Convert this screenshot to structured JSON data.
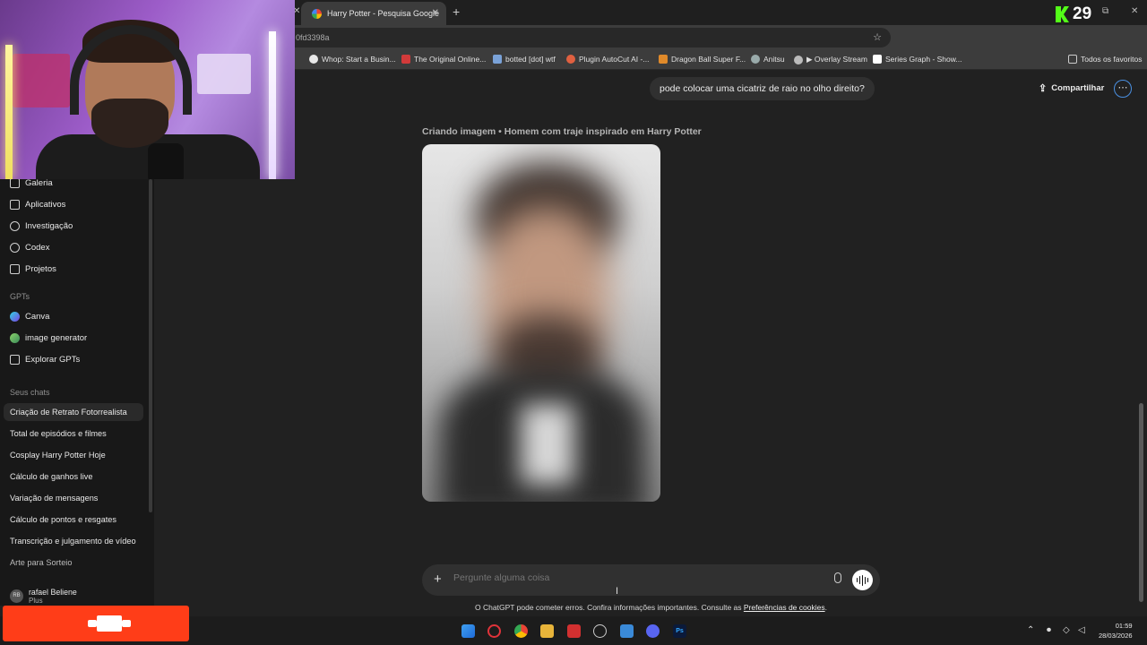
{
  "browser": {
    "tab_title": "Harry Potter - Pesquisa Google",
    "url_fragment": "0fd3398a",
    "kick_count": "29",
    "bookmarks": [
      {
        "label": "Whop: Start a Busin...",
        "color": "#e8e8e8"
      },
      {
        "label": "The Original Online...",
        "color": "#d23a3a"
      },
      {
        "label": "botted [dot] wtf",
        "color": "#7aa2d8"
      },
      {
        "label": "Plugin AutoCut AI -...",
        "color": "#e06040"
      },
      {
        "label": "Dragon Ball Super F...",
        "color": "#e08a2a"
      },
      {
        "label": "Anitsu",
        "color": "#9aa"
      },
      {
        "label": "▶ Overlay Stream",
        "color": "#bbb"
      },
      {
        "label": "Series Graph - Show...",
        "color": "#fff"
      }
    ],
    "all_bookmarks": "Todos os favoritos"
  },
  "sidebar": {
    "nav": [
      {
        "label": "Galeria",
        "icon": "gallery-icon"
      },
      {
        "label": "Aplicativos",
        "icon": "apps-icon"
      },
      {
        "label": "Investigação",
        "icon": "telescope-icon"
      },
      {
        "label": "Codex",
        "icon": "codex-icon"
      },
      {
        "label": "Projetos",
        "icon": "folder-icon"
      }
    ],
    "gpts_heading": "GPTs",
    "gpts": [
      {
        "label": "Canva",
        "icon": "canva-icon"
      },
      {
        "label": "image generator",
        "icon": "image-generator-icon"
      },
      {
        "label": "Explorar GPTs",
        "icon": "explore-icon"
      }
    ],
    "chats_heading": "Seus chats",
    "chats": [
      "Criação de Retrato Fotorrealista",
      "Total de episódios e filmes",
      "Cosplay Harry Potter Hoje",
      "Cálculo de ganhos live",
      "Variação de mensagens",
      "Cálculo de pontos e resgates",
      "Transcrição e julgamento de vídeo",
      "Arte para Sorteio"
    ],
    "user": {
      "initials": "RB",
      "name": "rafael Beliene",
      "plan": "Plus"
    }
  },
  "header": {
    "share_label": "Compartilhar"
  },
  "conversation": {
    "user_message": "pode colocar uma cicatriz de raio no olho direito?",
    "status": "Criando imagem • Homem com traje inspirado em Harry Potter"
  },
  "composer": {
    "placeholder": "Pergunte alguma coisa",
    "disclaimer_text": "O ChatGPT pode cometer erros. Confira informações importantes. Consulte as ",
    "disclaimer_link": "Preferências de cookies",
    "disclaimer_end": "."
  },
  "taskbar": {
    "time": "01:59",
    "date": "28/03/2026"
  }
}
